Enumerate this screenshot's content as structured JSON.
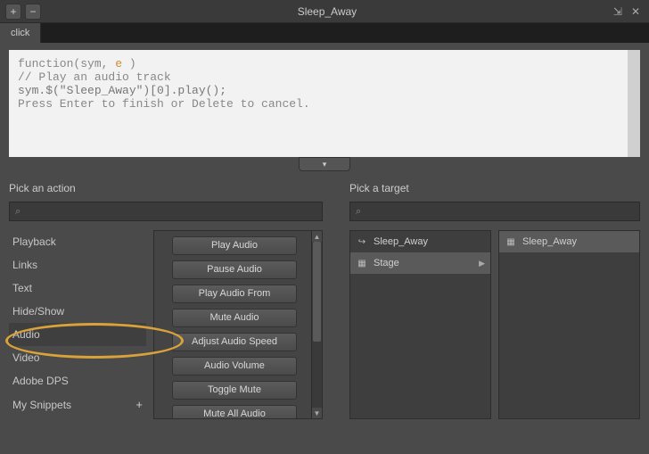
{
  "window": {
    "title": "Sleep_Away",
    "plus": "+",
    "minus": "−",
    "close": "✕"
  },
  "tab": {
    "label": "click"
  },
  "code": {
    "sig_prefix": "function(sym, ",
    "sig_param": "e",
    "sig_suffix": " )",
    "comment": "// Play an audio track",
    "line1": "sym.$(\"Sleep_Away\")[0].play();",
    "hint": "Press Enter to finish or Delete to cancel."
  },
  "expand_glyph": "▾",
  "action_panel": {
    "title": "Pick an action",
    "search_placeholder": "",
    "categories": [
      "Playback",
      "Links",
      "Text",
      "Hide/Show",
      "Audio",
      "Video",
      "Adobe DPS",
      "My Snippets"
    ],
    "snip_plus": "+",
    "actions": [
      "Play Audio",
      "Pause Audio",
      "Play Audio From",
      "Mute Audio",
      "Adjust Audio Speed",
      "Audio Volume",
      "Toggle Mute",
      "Mute All Audio"
    ]
  },
  "target_panel": {
    "title": "Pick a target",
    "col1": [
      {
        "icon": "↪",
        "label": "Sleep_Away",
        "selected": false,
        "chev": false
      },
      {
        "icon": "▦",
        "label": "Stage",
        "selected": true,
        "chev": true
      }
    ],
    "col2": [
      {
        "icon": "▦",
        "label": "Sleep_Away",
        "selected": true,
        "chev": false
      }
    ]
  }
}
